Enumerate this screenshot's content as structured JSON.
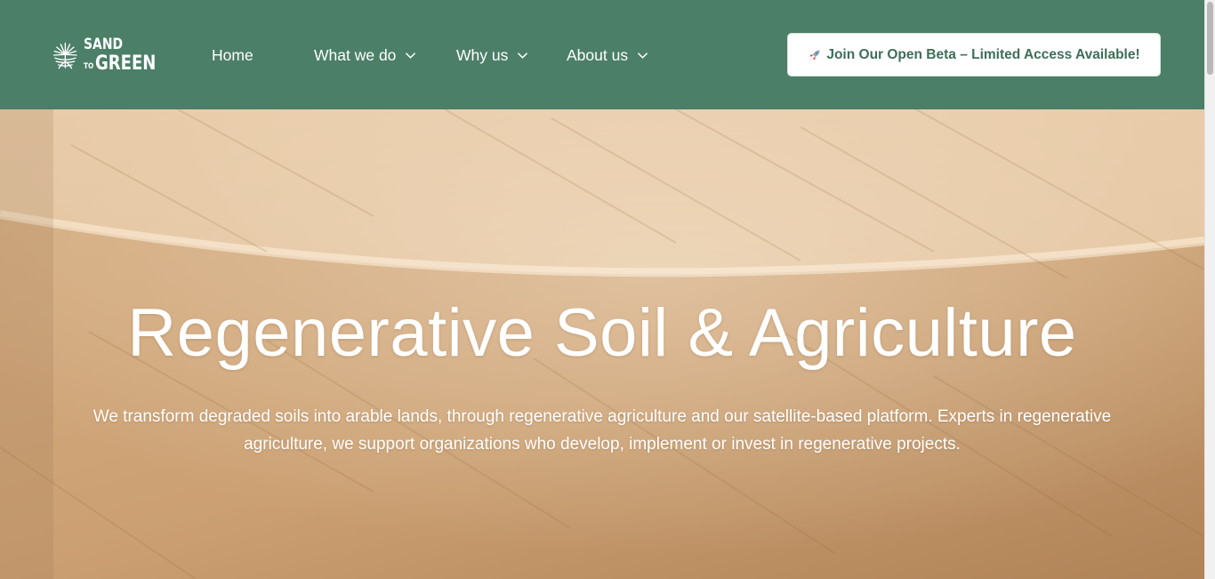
{
  "brand": {
    "logo_line1": "SAND",
    "logo_to": "TO",
    "logo_line2": "GREEN",
    "logo_icon": "tree-roots-icon"
  },
  "nav": {
    "items": [
      {
        "label": "Home",
        "has_dropdown": false
      },
      {
        "label": "What we do",
        "has_dropdown": true
      },
      {
        "label": "Why us",
        "has_dropdown": true
      },
      {
        "label": "About us",
        "has_dropdown": true
      }
    ]
  },
  "cta": {
    "icon": "rocket-icon",
    "label": "Join Our Open Beta – Limited Access Available!"
  },
  "hero": {
    "title": "Regenerative Soil & Agriculture",
    "subtitle_line1": "We transform degraded soils into arable lands, through regenerative agriculture and our satellite-based platform. Experts in regenerative",
    "subtitle_line2": "agriculture, we support organizations who develop, implement or invest in regenerative projects."
  },
  "colors": {
    "header_bg": "#4b7f68",
    "cta_text": "#3f6e58",
    "hero_sand": "#ddb98f"
  }
}
